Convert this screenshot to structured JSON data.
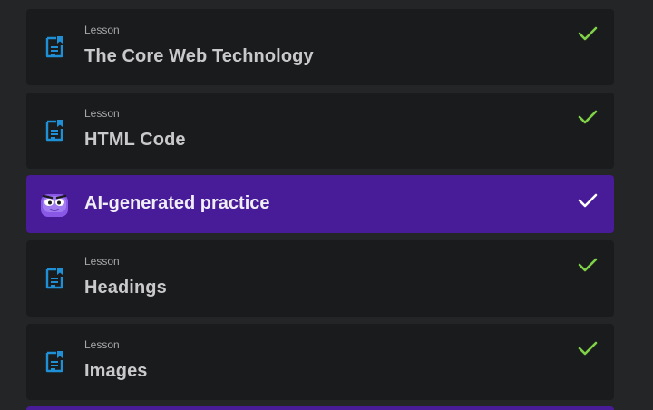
{
  "items": [
    {
      "type": "lesson",
      "overline": "Lesson",
      "title": "The Core Web Technology",
      "completed": true
    },
    {
      "type": "lesson",
      "overline": "Lesson",
      "title": "HTML Code",
      "completed": true
    },
    {
      "type": "ai",
      "title": "AI-generated practice",
      "completed": true
    },
    {
      "type": "lesson",
      "overline": "Lesson",
      "title": "Headings",
      "completed": true
    },
    {
      "type": "lesson",
      "overline": "Lesson",
      "title": "Images",
      "completed": true
    }
  ],
  "colors": {
    "background": "#242526",
    "card": "#1a1b1d",
    "ai_card": "#481c98",
    "lesson_icon": "#1f8fd6",
    "check_green": "#7fd147",
    "check_white": "#ffffff"
  },
  "icons": {
    "lesson": "document-icon",
    "completed": "checkmark-icon",
    "ai": "ai-avatar-icon"
  }
}
